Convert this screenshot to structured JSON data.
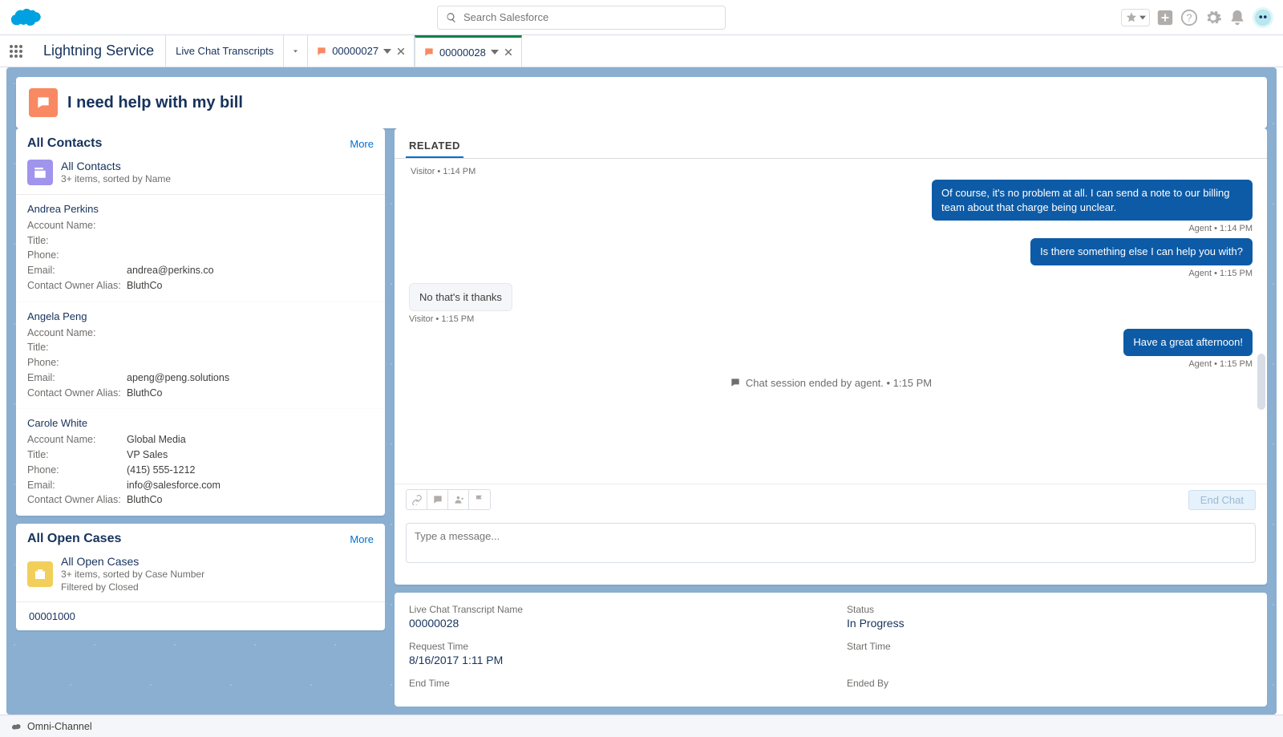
{
  "header": {
    "search_placeholder": "Search Salesforce"
  },
  "nav": {
    "app_name": "Lightning Service",
    "nav_item_label": "Live Chat Transcripts",
    "tabs": [
      {
        "label": "00000027",
        "active": false
      },
      {
        "label": "00000028",
        "active": true
      }
    ]
  },
  "page": {
    "title": "I need help with my bill"
  },
  "contacts_card": {
    "title": "All Contacts",
    "more": "More",
    "list_title": "All Contacts",
    "list_sub": "3+ items, sorted by Name",
    "items": [
      {
        "name": "Andrea Perkins",
        "account": "",
        "title": "",
        "phone": "",
        "email": "andrea@perkins.co",
        "owner_alias": "BluthCo"
      },
      {
        "name": "Angela Peng",
        "account": "",
        "title": "",
        "phone": "",
        "email": "apeng@peng.solutions",
        "owner_alias": "BluthCo"
      },
      {
        "name": "Carole White",
        "account": "Global Media",
        "title": "VP Sales",
        "phone": "(415) 555-1212",
        "email": "info@salesforce.com",
        "owner_alias": "BluthCo"
      }
    ],
    "field_labels": {
      "account": "Account Name:",
      "title": "Title:",
      "phone": "Phone:",
      "email": "Email:",
      "owner_alias": "Contact Owner Alias:"
    }
  },
  "cases_card": {
    "title": "All Open Cases",
    "more": "More",
    "list_title": "All Open Cases",
    "list_sub1": "3+ items, sorted by Case Number",
    "list_sub2": "Filtered by Closed",
    "row1": "00001000"
  },
  "chat": {
    "tab_related": "RELATED",
    "top_line": "Visitor • 1:14 PM",
    "messages": [
      {
        "role": "agent",
        "text": "Of course, it's no problem at all. I can send a note to our billing team about that charge being unclear.",
        "meta": "Agent • 1:14 PM"
      },
      {
        "role": "agent",
        "text": "Is there something else I can help you with?",
        "meta": "Agent • 1:15 PM"
      },
      {
        "role": "visitor",
        "text": "No that's it thanks",
        "meta": "Visitor • 1:15 PM"
      },
      {
        "role": "agent",
        "text": "Have a great afternoon!",
        "meta": "Agent • 1:15 PM"
      }
    ],
    "session_end": "Chat session ended by agent. • 1:15 PM",
    "composer_placeholder": "Type a message...",
    "end_chat": "End Chat"
  },
  "details": {
    "transcript_name_label": "Live Chat Transcript Name",
    "transcript_name": "00000028",
    "status_label": "Status",
    "status": "In Progress",
    "request_time_label": "Request Time",
    "request_time": "8/16/2017 1:11 PM",
    "start_time_label": "Start Time",
    "start_time": "",
    "end_time_label": "End Time",
    "ended_by_label": "Ended By"
  },
  "utility": {
    "omni": "Omni-Channel"
  }
}
